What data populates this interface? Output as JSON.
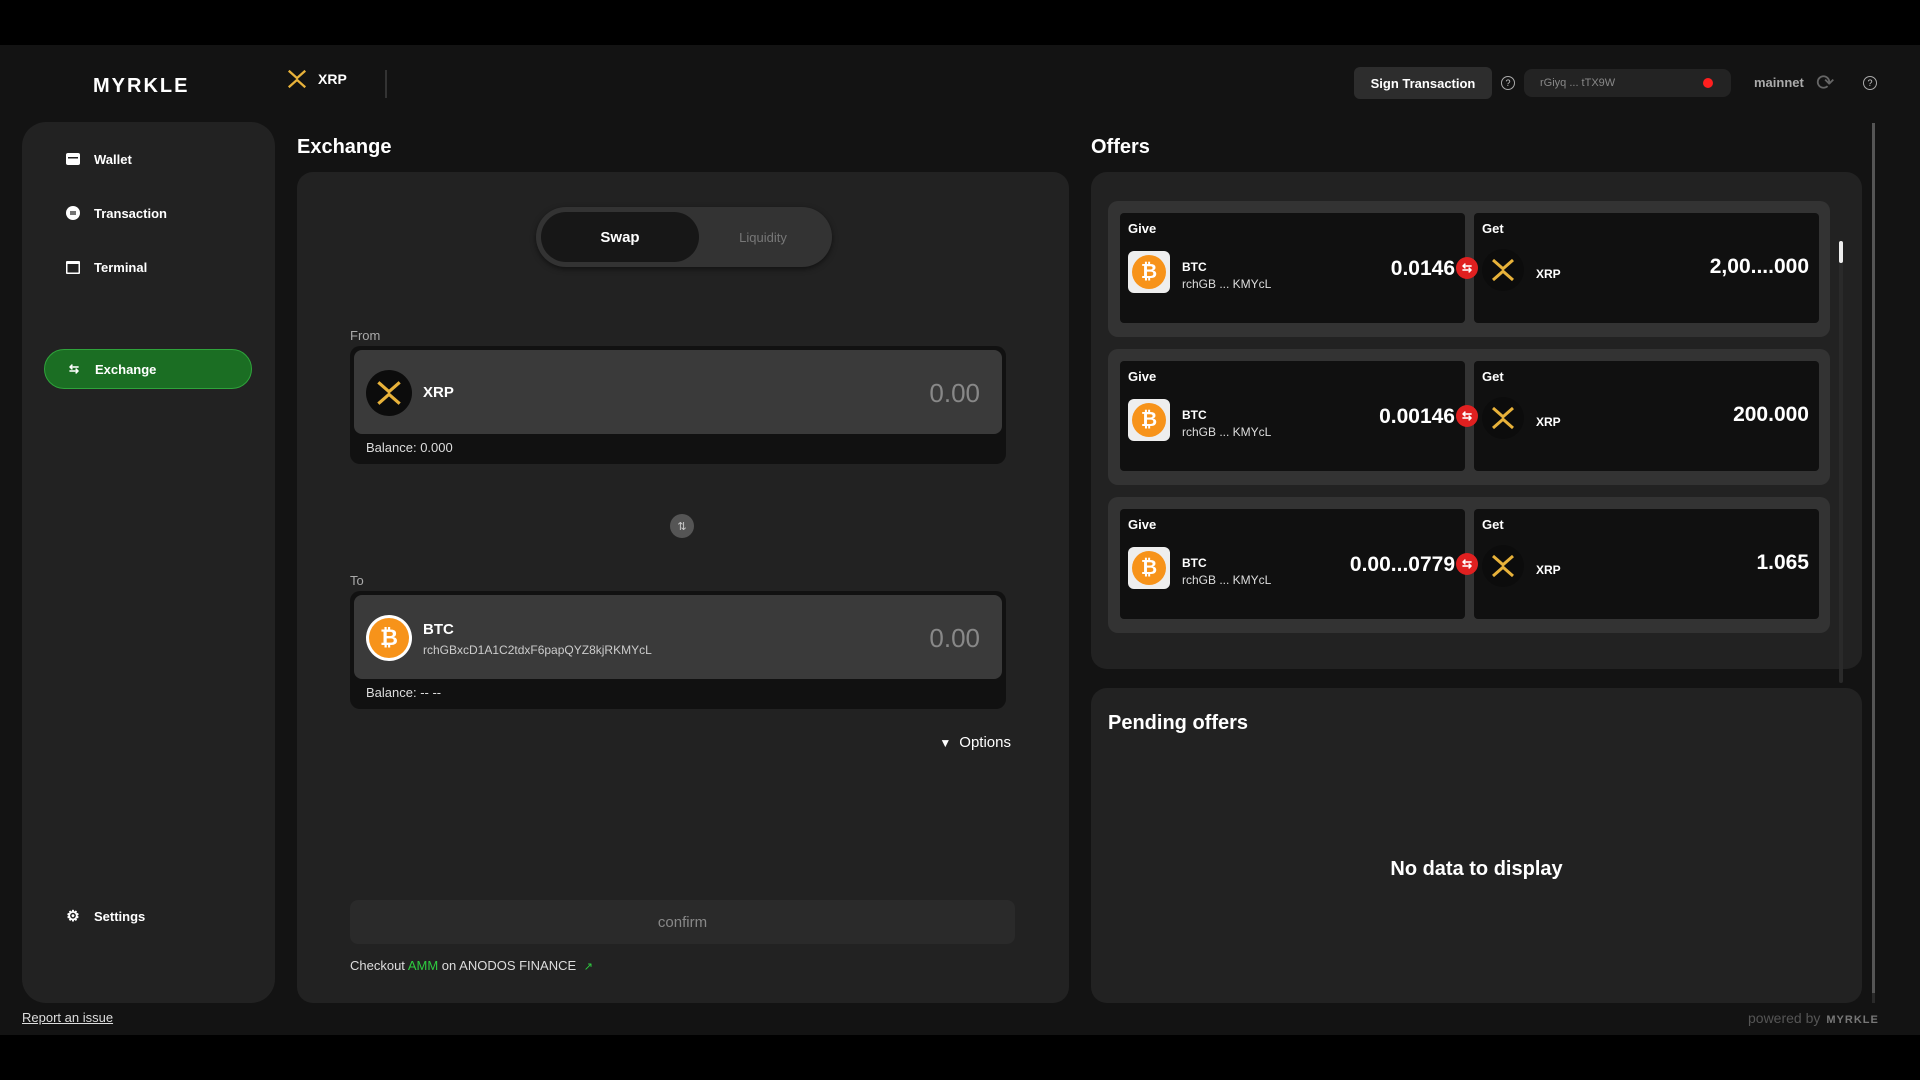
{
  "header": {
    "logo": "MYRKLE",
    "token": "XRP",
    "sign_button": "Sign Transaction",
    "address": "rGiyq ... tTX9W",
    "network": "mainnet",
    "status_color": "#ff1f1f"
  },
  "sidebar": {
    "items": [
      {
        "label": "Wallet",
        "icon": "wallet-icon"
      },
      {
        "label": "Transaction",
        "icon": "transaction-icon"
      },
      {
        "label": "Terminal",
        "icon": "terminal-icon"
      },
      {
        "label": "Exchange",
        "icon": "exchange-icon",
        "active": true
      }
    ],
    "settings": "Settings",
    "report": "Report an issue"
  },
  "exchange": {
    "title": "Exchange",
    "tabs": [
      "Swap",
      "Liquidity"
    ],
    "from_label": "From",
    "from_token": "XRP",
    "from_amount": "0.00",
    "from_balance": "Balance: 0.000",
    "to_label": "To",
    "to_token": "BTC",
    "to_issuer": "rchGBxcD1A1C2tdxF6papQYZ8kjRKMYcL",
    "to_amount": "0.00",
    "to_balance": "Balance: -- --",
    "options": "Options",
    "confirm": "confirm",
    "checkout_pre": "Checkout",
    "checkout_link": "AMM",
    "checkout_post": "on ANODOS FINANCE",
    "accent": "#2ecc40"
  },
  "offers": {
    "title": "Offers",
    "give_label": "Give",
    "get_label": "Get",
    "list": [
      {
        "give_token": "BTC",
        "give_issuer": "rchGB ... KMYcL",
        "give_amount": "0.0146",
        "get_token": "XRP",
        "get_amount": "2,00....000"
      },
      {
        "give_token": "BTC",
        "give_issuer": "rchGB ... KMYcL",
        "give_amount": "0.00146",
        "get_token": "XRP",
        "get_amount": "200.000"
      },
      {
        "give_token": "BTC",
        "give_issuer": "rchGB ... KMYcL",
        "give_amount": "0.00...0779",
        "get_token": "XRP",
        "get_amount": "1.065"
      }
    ]
  },
  "pending": {
    "title": "Pending offers",
    "empty": "No data to display"
  },
  "footer": {
    "powered": "powered by",
    "brand": "MYRKLE"
  }
}
